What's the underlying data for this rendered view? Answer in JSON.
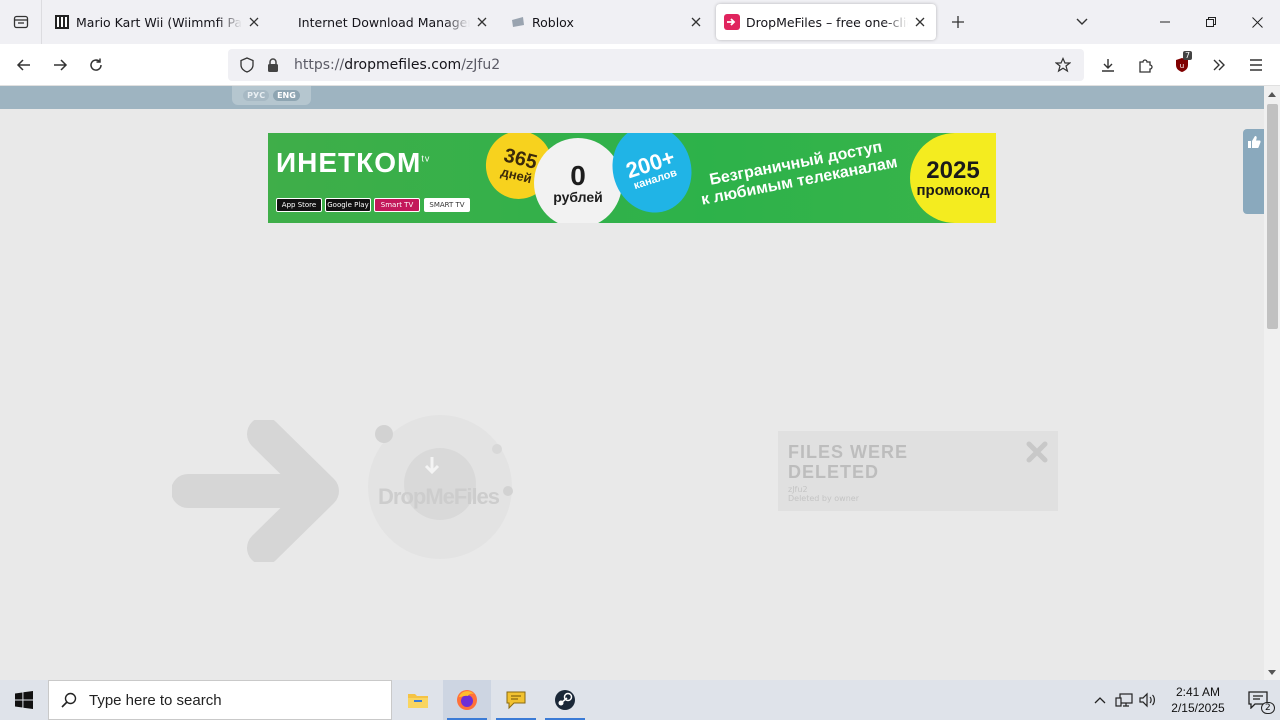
{
  "browser": {
    "tabs": [
      {
        "title": "Mario Kart Wii (Wiimmfi Patche",
        "favicon": "wiimmfi-icon",
        "active": false
      },
      {
        "title": "Internet Download Manager is a",
        "favicon": "none",
        "active": false
      },
      {
        "title": "Roblox",
        "favicon": "roblox-icon",
        "active": false
      },
      {
        "title": "DropMeFiles – free one-click file",
        "favicon": "dropmefiles-icon",
        "active": true
      }
    ],
    "url_scheme": "https://",
    "url_host": "dropmefiles.com",
    "url_path": "/zJfu2",
    "extension_badge": "7"
  },
  "page": {
    "languages": [
      "РУС",
      "ENG"
    ],
    "active_language": "ENG",
    "banner": {
      "brand": "ИНЕТКОМ",
      "brand_suffix": "tv",
      "stores": [
        "App Store",
        "Google Play",
        "Smart TV",
        "SMART TV"
      ],
      "days_num": "365",
      "days_label": "дней",
      "rub_num": "0",
      "rub_label": "рублей",
      "channels_num": "200+",
      "channels_label": "каналов",
      "slogan_line1": "Безграничный доступ",
      "slogan_line2": "к любимым телеканалам",
      "promo_year": "2025",
      "promo_label": "промокод"
    },
    "logo_text_a": "DropMe",
    "logo_text_b": "Files",
    "notice": {
      "title_line1": "FILES WERE",
      "title_line2": "DELETED",
      "code": "zJfu2",
      "reason": "Deleted by owner"
    }
  },
  "taskbar": {
    "search_placeholder": "Type here to search",
    "time": "2:41 AM",
    "date": "2/15/2025",
    "notification_count": "2"
  },
  "colors": {
    "page_bg": "#e9e9e9",
    "top_strip": "#9eb4c1",
    "banner_green": "#2db24a",
    "promo_yellow": "#f4ec1f",
    "taskbar": "#dfe3ea"
  }
}
